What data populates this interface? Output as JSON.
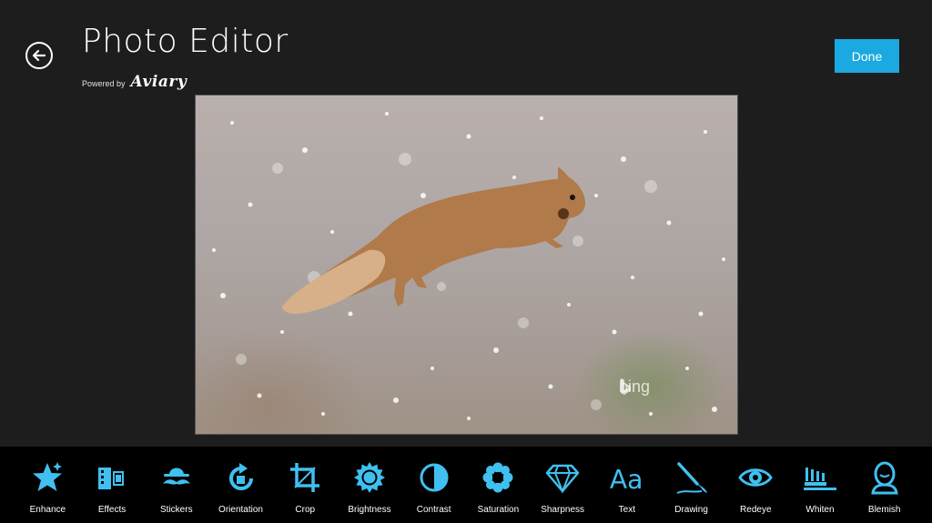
{
  "header": {
    "title": "Photo Editor",
    "powered_by": "Powered by",
    "brand": "Aviary",
    "done_label": "Done"
  },
  "photo": {
    "watermark": "bing"
  },
  "toolbar": {
    "items": [
      {
        "label": "Enhance",
        "icon": "star-icon"
      },
      {
        "label": "Effects",
        "icon": "film-icon"
      },
      {
        "label": "Stickers",
        "icon": "mustache-hat-icon"
      },
      {
        "label": "Orientation",
        "icon": "rotate-icon"
      },
      {
        "label": "Crop",
        "icon": "crop-icon"
      },
      {
        "label": "Brightness",
        "icon": "sun-icon"
      },
      {
        "label": "Contrast",
        "icon": "contrast-icon"
      },
      {
        "label": "Saturation",
        "icon": "flower-icon"
      },
      {
        "label": "Sharpness",
        "icon": "diamond-icon"
      },
      {
        "label": "Text",
        "icon": "text-icon"
      },
      {
        "label": "Drawing",
        "icon": "brush-icon"
      },
      {
        "label": "Redeye",
        "icon": "eye-icon"
      },
      {
        "label": "Whiten",
        "icon": "toothbrush-icon"
      },
      {
        "label": "Blemish",
        "icon": "face-icon"
      }
    ]
  },
  "colors": {
    "accent": "#1aa9e0",
    "icon": "#3fc0f0",
    "background": "#1d1d1d",
    "toolbar": "#000000"
  }
}
